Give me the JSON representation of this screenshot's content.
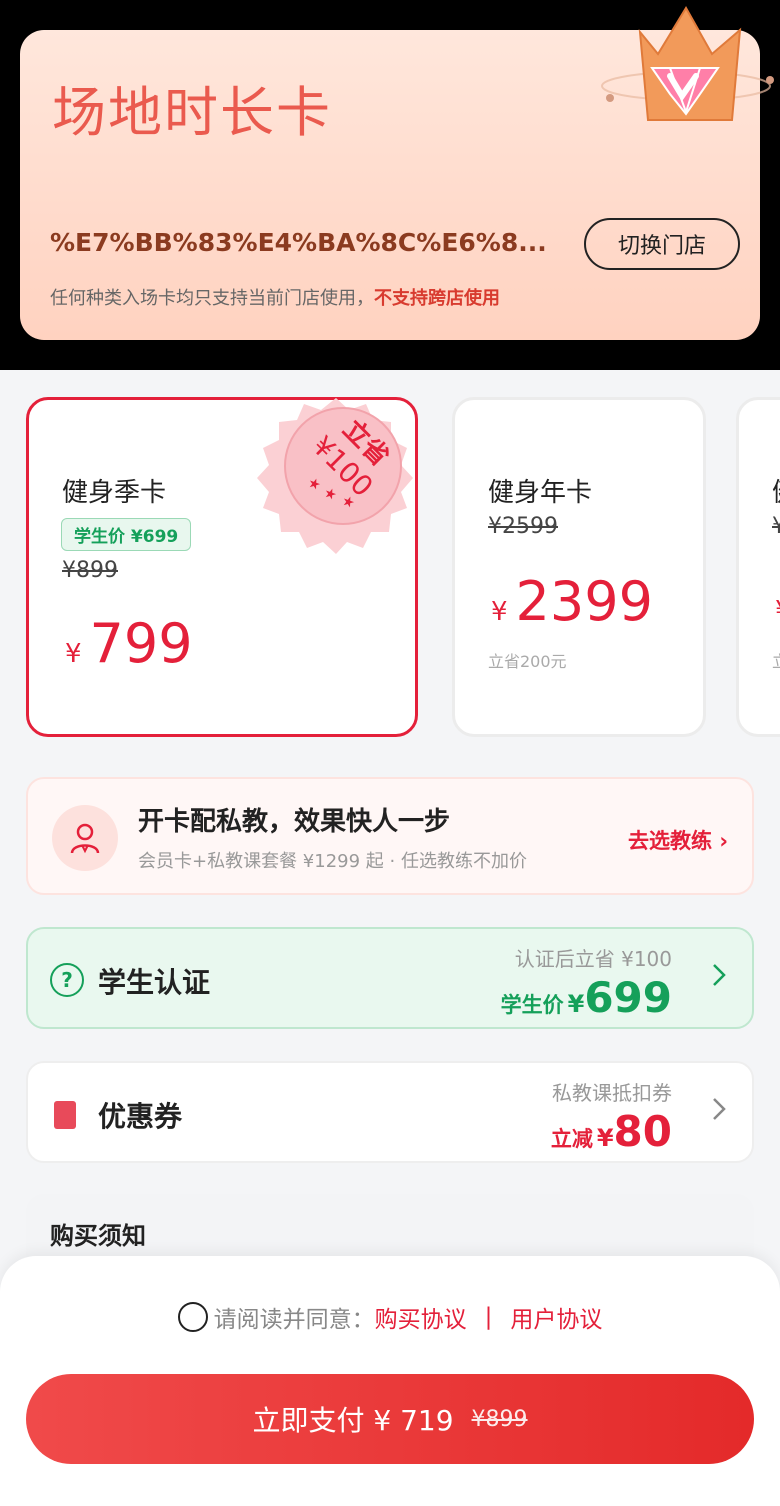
{
  "hero": {
    "title": "场地时长卡",
    "store_name": "%E7%BB%83%E4%BA%8C%E6%8...",
    "switch_label": "切换门店",
    "note_prefix": "任何种类入场卡均只支持当前门店使用，",
    "note_highlight": "不支持跨店使用"
  },
  "cards": [
    {
      "name": "健身季卡",
      "student_tag": "学生价 ¥699",
      "original": "¥899",
      "currency": "¥",
      "price": "799",
      "badge_title": "立省",
      "badge_amount": "¥100",
      "selected": true
    },
    {
      "name": "健身年卡",
      "original": "¥2599",
      "currency": "¥",
      "price": "2399",
      "save_note": "立省200元",
      "selected": false
    },
    {
      "name": "健",
      "original": "¥",
      "currency": "¥",
      "save_note": "立",
      "selected": false
    }
  ],
  "coach": {
    "title": "开卡配私教，效果快人一步",
    "subtitle": "会员卡+私教课套餐 ¥1299 起 · 任选教练不加价",
    "link": "去选教练 ›"
  },
  "student": {
    "icon_text": "?",
    "title": "学生认证",
    "hint": "认证后立省 ¥100",
    "price_label": "学生价",
    "currency": "¥",
    "price": "699"
  },
  "coupon": {
    "title": "优惠券",
    "hint": "私教课抵扣券",
    "price_label": "立减",
    "currency": "¥",
    "amount": "80"
  },
  "notice": {
    "title": "购买须知"
  },
  "footer": {
    "agree_text": "请阅读并同意：",
    "link_purchase": "购买协议",
    "separator": "|",
    "link_user": "用户协议",
    "pay_label": "立即支付 ¥ 719",
    "pay_original": "¥899"
  },
  "colors": {
    "accent_red": "#e4203a",
    "student_green": "#15a05a",
    "hero_title": "#ea5a4e"
  }
}
